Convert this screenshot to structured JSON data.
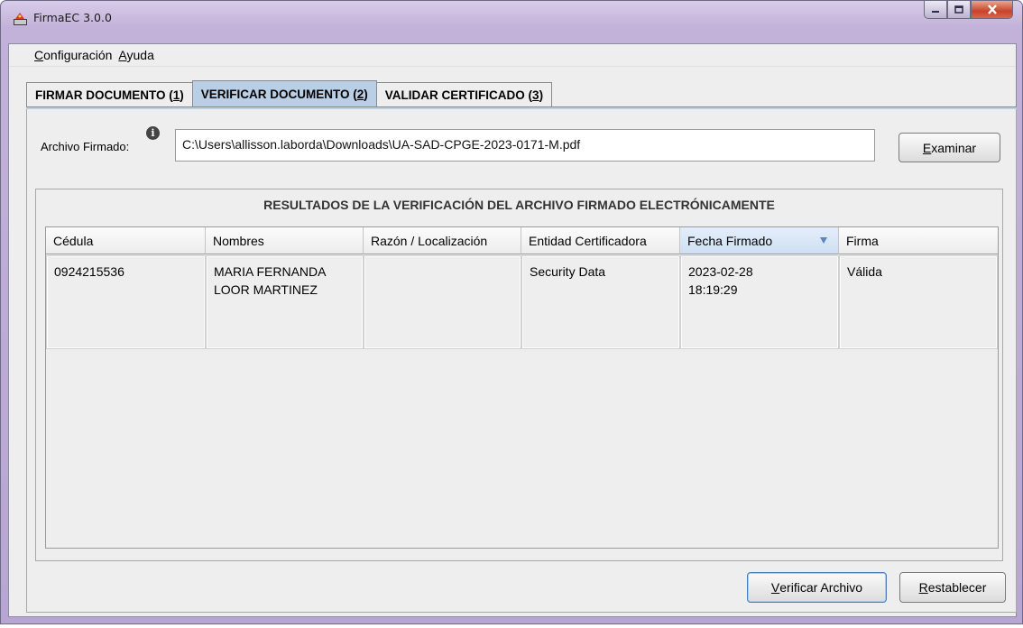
{
  "window": {
    "title": "FirmaEC 3.0.0"
  },
  "menubar": [
    {
      "label": "Configuración",
      "mnemonic": "C",
      "rest": "onfiguración"
    },
    {
      "label": "Ayuda",
      "mnemonic": "A",
      "rest": "yuda"
    }
  ],
  "tabs": [
    {
      "pre": "FIRMAR DOCUMENTO (",
      "key": "1",
      "post": ")",
      "active": false
    },
    {
      "pre": "VERIFICAR DOCUMENTO (",
      "key": "2",
      "post": ")",
      "active": true
    },
    {
      "pre": "VALIDAR CERTIFICADO (",
      "key": "3",
      "post": ")",
      "active": false
    }
  ],
  "file": {
    "label": "Archivo Firmado:",
    "value": "C:\\Users\\allisson.laborda\\Downloads\\UA-SAD-CPGE-2023-0171-M.pdf",
    "browse_mnemonic": "E",
    "browse_rest": "xaminar"
  },
  "results": {
    "title": "RESULTADOS DE LA VERIFICACIÓN DEL ARCHIVO FIRMADO ELECTRÓNICAMENTE",
    "columns": [
      "Cédula",
      "Nombres",
      "Razón / Localización",
      "Entidad Certificadora",
      "Fecha Firmado",
      "Firma"
    ],
    "sorted_column": "Fecha Firmado",
    "rows": [
      {
        "cedula": "0924215536",
        "nombres_1": "MARIA FERNANDA",
        "nombres_2": "LOOR MARTINEZ",
        "razon": "",
        "entidad": "Security Data",
        "fecha_1": "2023-02-28",
        "fecha_2": "18:19:29",
        "firma": "Válida"
      }
    ]
  },
  "actions": {
    "verify_mnemonic": "V",
    "verify_rest": "erificar Archivo",
    "reset_mnemonic": "R",
    "reset_rest": "establecer"
  }
}
